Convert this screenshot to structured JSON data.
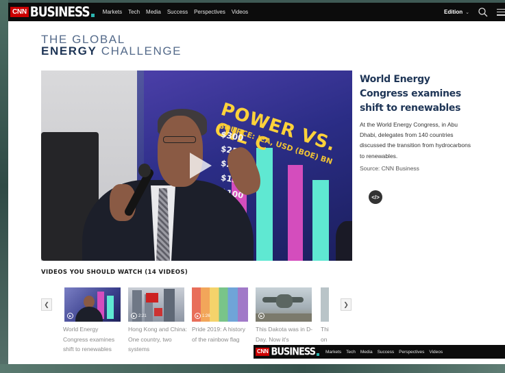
{
  "nav": {
    "logo_cnn": "CNN",
    "logo_business": "BUSINESS",
    "links": [
      "Markets",
      "Tech",
      "Media",
      "Success",
      "Perspectives",
      "Videos"
    ],
    "edition": "Edition"
  },
  "page_title": {
    "line1": "THE GLOBAL",
    "line2_bold": "ENERGY",
    "line2_rest": " CHALLENGE"
  },
  "video": {
    "screen_headline": "POWER VS. OIL C",
    "screen_source": "SOURCE: IEA, USD (BOE) BN",
    "screen_values": [
      "$300",
      "$250",
      "$200",
      "$150",
      "$100"
    ]
  },
  "article": {
    "headline": "World Energy Congress examines shift to renewables",
    "body": "At the World Energy Congress, in Abu Dhabi, delegates from 140 countries discussed the transition from hydrocarbons to renewables.",
    "source": "Source: CNN Business"
  },
  "carousel": {
    "title": "VIDEOS YOU SHOULD WATCH (14 VIDEOS)",
    "items": [
      {
        "caption": "World Energy Congress examines shift to renewables",
        "duration": "",
        "theme": "#4b4fa0"
      },
      {
        "caption": "Hong Kong and China: One country, two systems",
        "duration": "2:21",
        "theme": "#9aa3b0"
      },
      {
        "caption": "Pride 2019: A history of the rainbow flag",
        "duration": "1:26",
        "theme": "#e86e5a"
      },
      {
        "caption": "This Dakota was in D-Day. Now it's",
        "duration": "",
        "theme": "#a9b3b9"
      },
      {
        "caption": "Thi on",
        "duration": "",
        "theme": "#b9c4c8"
      }
    ]
  },
  "sticky_nav": {
    "logo_cnn": "CNN",
    "logo_business": "BUSINESS",
    "links": [
      "Markets",
      "Tech",
      "Media",
      "Success",
      "Perspectives",
      "Videos"
    ]
  },
  "colors": {
    "accent_red": "#cc0000",
    "navy": "#1e3556",
    "teal_dot": "#2bb5b0"
  }
}
